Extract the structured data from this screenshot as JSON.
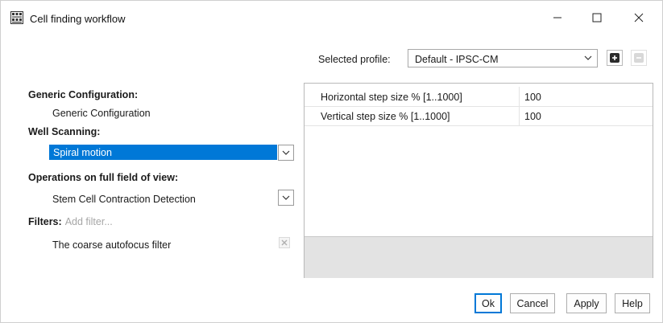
{
  "window": {
    "title": "Cell finding workflow",
    "accent_color": "#0078d7"
  },
  "profile": {
    "label": "Selected profile:",
    "value": "Default - IPSC-CM"
  },
  "left": {
    "generic_heading": "Generic Configuration:",
    "generic_value": "Generic Configuration",
    "well_heading": "Well Scanning:",
    "well_value": "Spiral motion",
    "ops_heading": "Operations on full field of view:",
    "ops_value": "Stem Cell Contraction Detection",
    "filters_label": "Filters:",
    "filters_add": "Add filter...",
    "filter_item": "The coarse autofocus filter"
  },
  "grid": {
    "rows": [
      {
        "name": "Horizontal step size % [1..1000]",
        "value": "100"
      },
      {
        "name": "Vertical step size % [1..1000]",
        "value": "100"
      }
    ]
  },
  "buttons": {
    "ok": "Ok",
    "cancel": "Cancel",
    "apply": "Apply",
    "help": "Help"
  },
  "icons": {
    "app": "app-icon",
    "minimize": "minimize-icon",
    "maximize": "maximize-icon",
    "close": "close-icon",
    "chevron": "chevron-down-icon",
    "add": "plus-icon",
    "remove": "minus-icon",
    "remove_filter": "close-small-icon"
  }
}
